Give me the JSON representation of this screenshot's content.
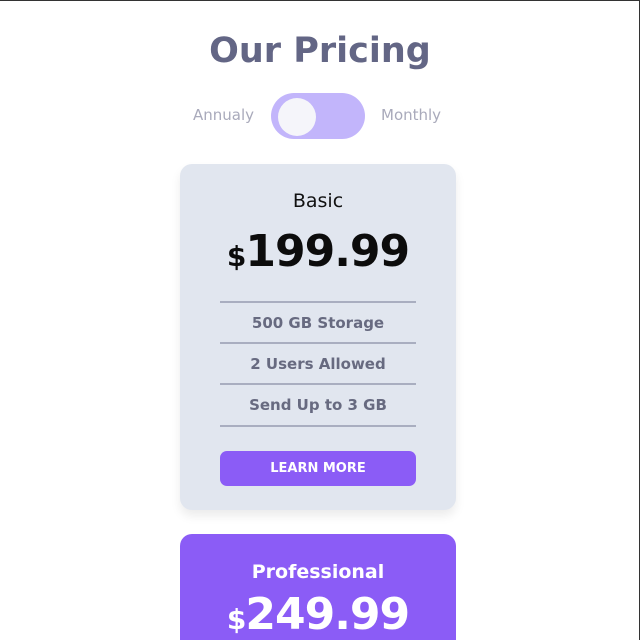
{
  "title": "Our Pricing",
  "toggle": {
    "left_label": "Annualy",
    "right_label": "Monthly"
  },
  "plans": [
    {
      "name": "Basic",
      "currency": "$",
      "price": "199.99",
      "features": [
        "500 GB Storage",
        "2 Users Allowed",
        "Send Up to 3 GB"
      ],
      "button": "LEARN MORE"
    },
    {
      "name": "Professional",
      "currency": "$",
      "price": "249.99"
    }
  ],
  "colors": {
    "accent": "#8b5cf6",
    "card": "#e1e6ef",
    "toggle": "#c2b5fb"
  }
}
